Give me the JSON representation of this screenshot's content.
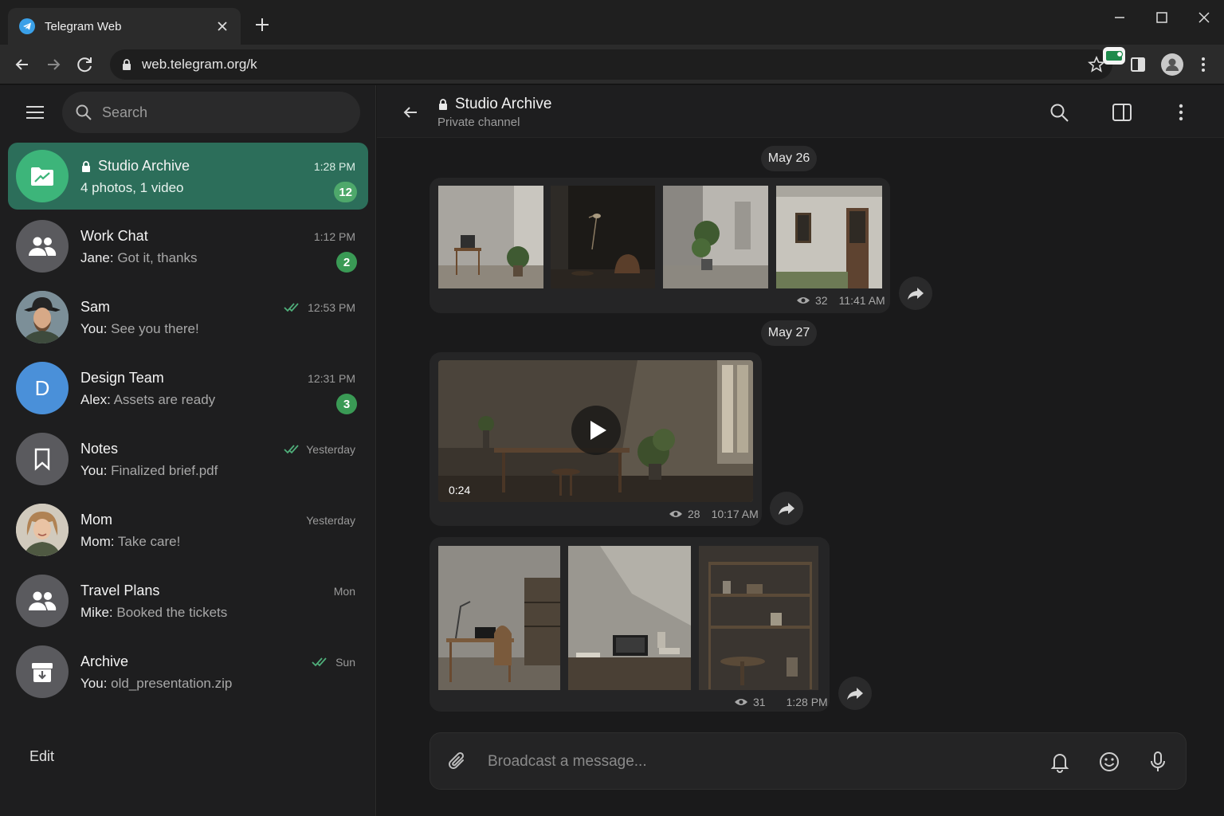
{
  "browser": {
    "tab_title": "Telegram Web",
    "url": "web.telegram.org/k",
    "icons": [
      "telegram-icon",
      "close-icon",
      "plus-icon",
      "minimize-icon",
      "maximize-icon",
      "window-close-icon",
      "back-arrow-icon",
      "forward-arrow-icon",
      "reload-icon",
      "lock-icon",
      "star-icon",
      "sidepanel-icon",
      "profile-icon",
      "kebab-icon"
    ]
  },
  "sidebar": {
    "search_placeholder": "Search",
    "edit_label": "Edit",
    "chats": [
      {
        "name": "Studio Archive",
        "sender": "",
        "preview": "4 photos, 1 video",
        "time": "1:28 PM",
        "badge": "12",
        "locked": true,
        "checks": false,
        "active": true
      },
      {
        "name": "Work Chat",
        "sender": "Jane:",
        "preview": "Got it, thanks",
        "time": "1:12 PM",
        "badge": "2",
        "locked": false,
        "checks": false,
        "active": false
      },
      {
        "name": "Sam",
        "sender": "You:",
        "preview": "See you there!",
        "time": "12:53 PM",
        "badge": "",
        "locked": false,
        "checks": true,
        "active": false
      },
      {
        "name": "Design Team",
        "sender": "Alex:",
        "preview": "Assets are ready",
        "time": "12:31 PM",
        "badge": "3",
        "locked": false,
        "checks": false,
        "active": false,
        "initial": "D"
      },
      {
        "name": "Notes",
        "sender": "You:",
        "preview": "Finalized brief.pdf",
        "time": "Yesterday",
        "badge": "",
        "locked": false,
        "checks": true,
        "active": false
      },
      {
        "name": "Mom",
        "sender": "Mom:",
        "preview": "Take care!",
        "time": "Yesterday",
        "badge": "",
        "locked": false,
        "checks": false,
        "active": false
      },
      {
        "name": "Travel Plans",
        "sender": "Mike:",
        "preview": "Booked the tickets",
        "time": "Mon",
        "badge": "",
        "locked": false,
        "checks": false,
        "active": false
      },
      {
        "name": "Archive",
        "sender": "You:",
        "preview": "old_presentation.zip",
        "time": "Sun",
        "badge": "",
        "locked": false,
        "checks": true,
        "active": false
      }
    ]
  },
  "channel": {
    "title": "Studio Archive",
    "subtitle": "Private channel",
    "composer_placeholder": "Broadcast a message...",
    "dates": [
      "May 26",
      "May 27"
    ],
    "messages": [
      {
        "views": "32",
        "time": "11:41 AM"
      },
      {
        "views": "28",
        "time": "10:17 AM",
        "duration": "0:24"
      },
      {
        "views": "31",
        "time": "1:28 PM"
      }
    ]
  },
  "colors": {
    "accent": "#2c6e5a",
    "badge": "#3a9a55",
    "design_team_avatar": "#4a90d9"
  }
}
